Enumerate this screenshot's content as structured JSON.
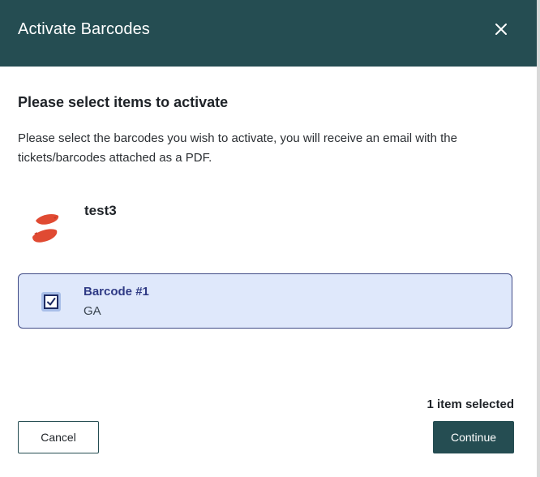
{
  "dialog": {
    "title": "Activate Barcodes",
    "close_icon": "close-icon"
  },
  "content": {
    "heading": "Please select items to activate",
    "description": "Please select the barcodes you wish to activate, you will receive an email with the tickets/barcodes attached as a PDF.",
    "event": {
      "name": "test3",
      "logo_icon": "brush-stroke-logo",
      "logo_color": "#e04a32"
    },
    "barcodes": [
      {
        "name": "Barcode #1",
        "type": "GA",
        "checked": true
      }
    ]
  },
  "footer": {
    "selected_count": "1 item selected",
    "cancel_label": "Cancel",
    "continue_label": "Continue"
  },
  "colors": {
    "header_bg": "#254d52",
    "selected_card_bg": "#dfe8fb",
    "selected_card_border": "#3f4a86",
    "accent_text": "#2f3a85"
  }
}
